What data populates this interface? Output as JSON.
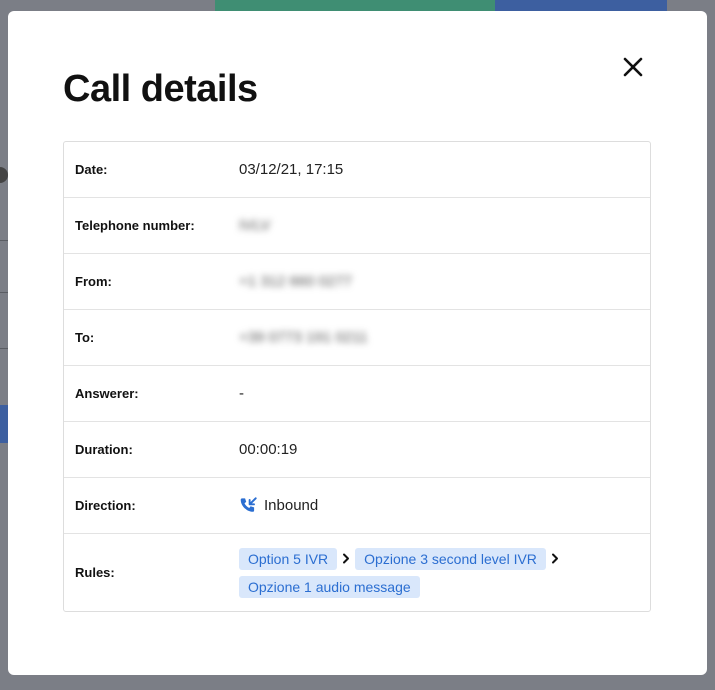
{
  "modal": {
    "title": "Call details",
    "close_label": "×"
  },
  "details": [
    {
      "label": "Date:",
      "value": "03/12/21, 17:15"
    },
    {
      "label": "Telephone number:",
      "value": "IVLV"
    },
    {
      "label": "From:",
      "value": "+1 312 660 0277"
    },
    {
      "label": "To:",
      "value": "+39 0773 191 0211"
    },
    {
      "label": "Answerer:",
      "value": "-"
    },
    {
      "label": "Duration:",
      "value": "00:00:19"
    },
    {
      "label": "Direction:",
      "value": "Inbound",
      "icon": "inbound-call-icon"
    },
    {
      "label": "Rules:",
      "chips": [
        "Option 5 IVR",
        "Opzione 3 second level IVR",
        "Opzione 1 audio message"
      ]
    }
  ],
  "colors": {
    "accent": "#2b6ed1",
    "chip_bg": "#d9e7fb",
    "overlay": "#7b7e86"
  }
}
